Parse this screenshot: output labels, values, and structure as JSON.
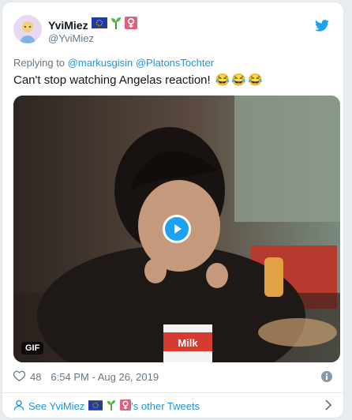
{
  "user": {
    "name": "YviMiez",
    "handle": "@YviMiez"
  },
  "reply": {
    "prefix": "Replying to",
    "mentions": [
      "@markusgisin",
      "@PlatonsTochter"
    ]
  },
  "tweet": {
    "text": "Can't stop watching Angelas reaction!",
    "emojis": [
      "😂",
      "😂",
      "😂"
    ]
  },
  "media": {
    "badge": "GIF",
    "milk_label": "Milk"
  },
  "meta": {
    "likes": "48",
    "timestamp": "6:54 PM - Aug 26, 2019"
  },
  "footer": {
    "see_prefix": "See YviMiez",
    "see_suffix": "'s other Tweets"
  },
  "colors": {
    "accent": "#1da1f2",
    "like": "#e0245e"
  }
}
